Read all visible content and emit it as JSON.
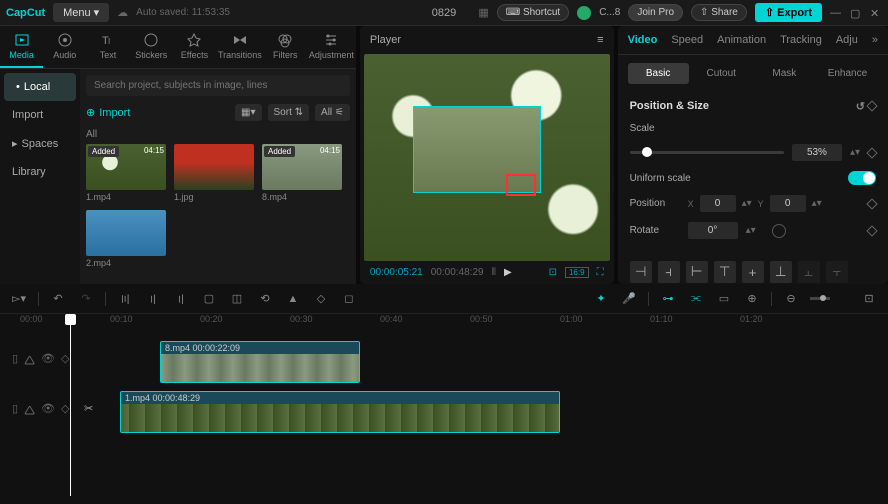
{
  "app": {
    "name": "CapCut",
    "menu_label": "Menu",
    "autosave": "Auto saved: 11:53:35",
    "title": "0829"
  },
  "topbar": {
    "shortcut": "Shortcut",
    "user": "C...8",
    "join_pro": "Join Pro",
    "share": "Share",
    "export": "Export"
  },
  "media_tabs": [
    "Media",
    "Audio",
    "Text",
    "Stickers",
    "Effects",
    "Transitions",
    "Filters",
    "Adjustment"
  ],
  "sidebar": {
    "items": [
      "Local",
      "Import",
      "Spaces",
      "Library"
    ]
  },
  "media": {
    "search_placeholder": "Search project, subjects in image, lines",
    "import_label": "Import",
    "sort_label": "Sort",
    "all_label": "All",
    "section_label": "All",
    "thumbs": [
      {
        "name": "1.mp4",
        "added": true,
        "dur": "04:15"
      },
      {
        "name": "1.jpg",
        "added": false
      },
      {
        "name": "8.mp4",
        "added": true,
        "dur": "04:15"
      },
      {
        "name": "2.mp4",
        "added": false
      }
    ]
  },
  "player": {
    "title": "Player",
    "current": "00:00:05:21",
    "total": "00:00:48:29"
  },
  "right": {
    "tabs": [
      "Video",
      "Speed",
      "Animation",
      "Tracking",
      "Adju"
    ],
    "subtabs": [
      "Basic",
      "Cutout",
      "Mask",
      "Enhance"
    ],
    "section_title": "Position & Size",
    "scale_label": "Scale",
    "scale_value": "53%",
    "uniform_label": "Uniform scale",
    "position_label": "Position",
    "pos_x": "0",
    "pos_y": "0",
    "rotate_label": "Rotate",
    "rotate_value": "0°"
  },
  "timeline": {
    "ticks": [
      "00:00",
      "00:10",
      "00:20",
      "00:30",
      "00:40",
      "00:50",
      "01:00",
      "01:10",
      "01:20"
    ],
    "clip1": {
      "label": "8.mp4  00:00:22:09"
    },
    "clip2": {
      "label": "1.mp4  00:00:48:29"
    }
  }
}
